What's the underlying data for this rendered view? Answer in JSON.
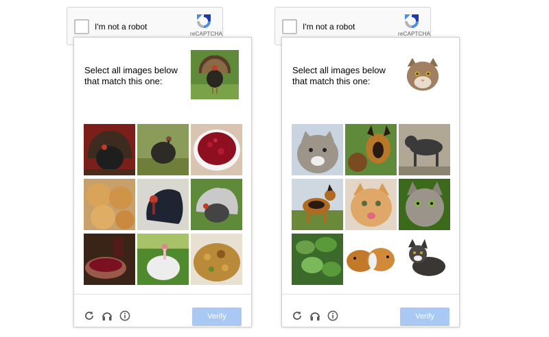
{
  "widgets": [
    {
      "anchor_label": "I'm not a robot",
      "brand": "reCAPTCHA",
      "instruction": "Select all images below that match this one:",
      "reference": "turkey",
      "tiles": [
        "turkey",
        "turkey",
        "cranberry-sauce",
        "bread-rolls",
        "turkey",
        "turkey",
        "cranberry-dish",
        "turkey",
        "stuffing"
      ],
      "verify_label": "Verify"
    },
    {
      "anchor_label": "I'm not a robot",
      "brand": "reCAPTCHA",
      "instruction": "Select all images below that match this one:",
      "reference": "cat",
      "tiles": [
        "kitten",
        "german-shepherd-puppies",
        "dog",
        "german-shepherd",
        "kitten",
        "kitten",
        "catnip-plant",
        "guinea-pigs",
        "kitten"
      ],
      "verify_label": "Verify"
    }
  ],
  "colors": {
    "verify": "#a9c8f4",
    "recaptcha_blue": "#1c3aa9",
    "recaptcha_light": "#4a90e2",
    "border": "#d3d3d3"
  },
  "icons": [
    "reload-icon",
    "audio-icon",
    "info-icon"
  ]
}
